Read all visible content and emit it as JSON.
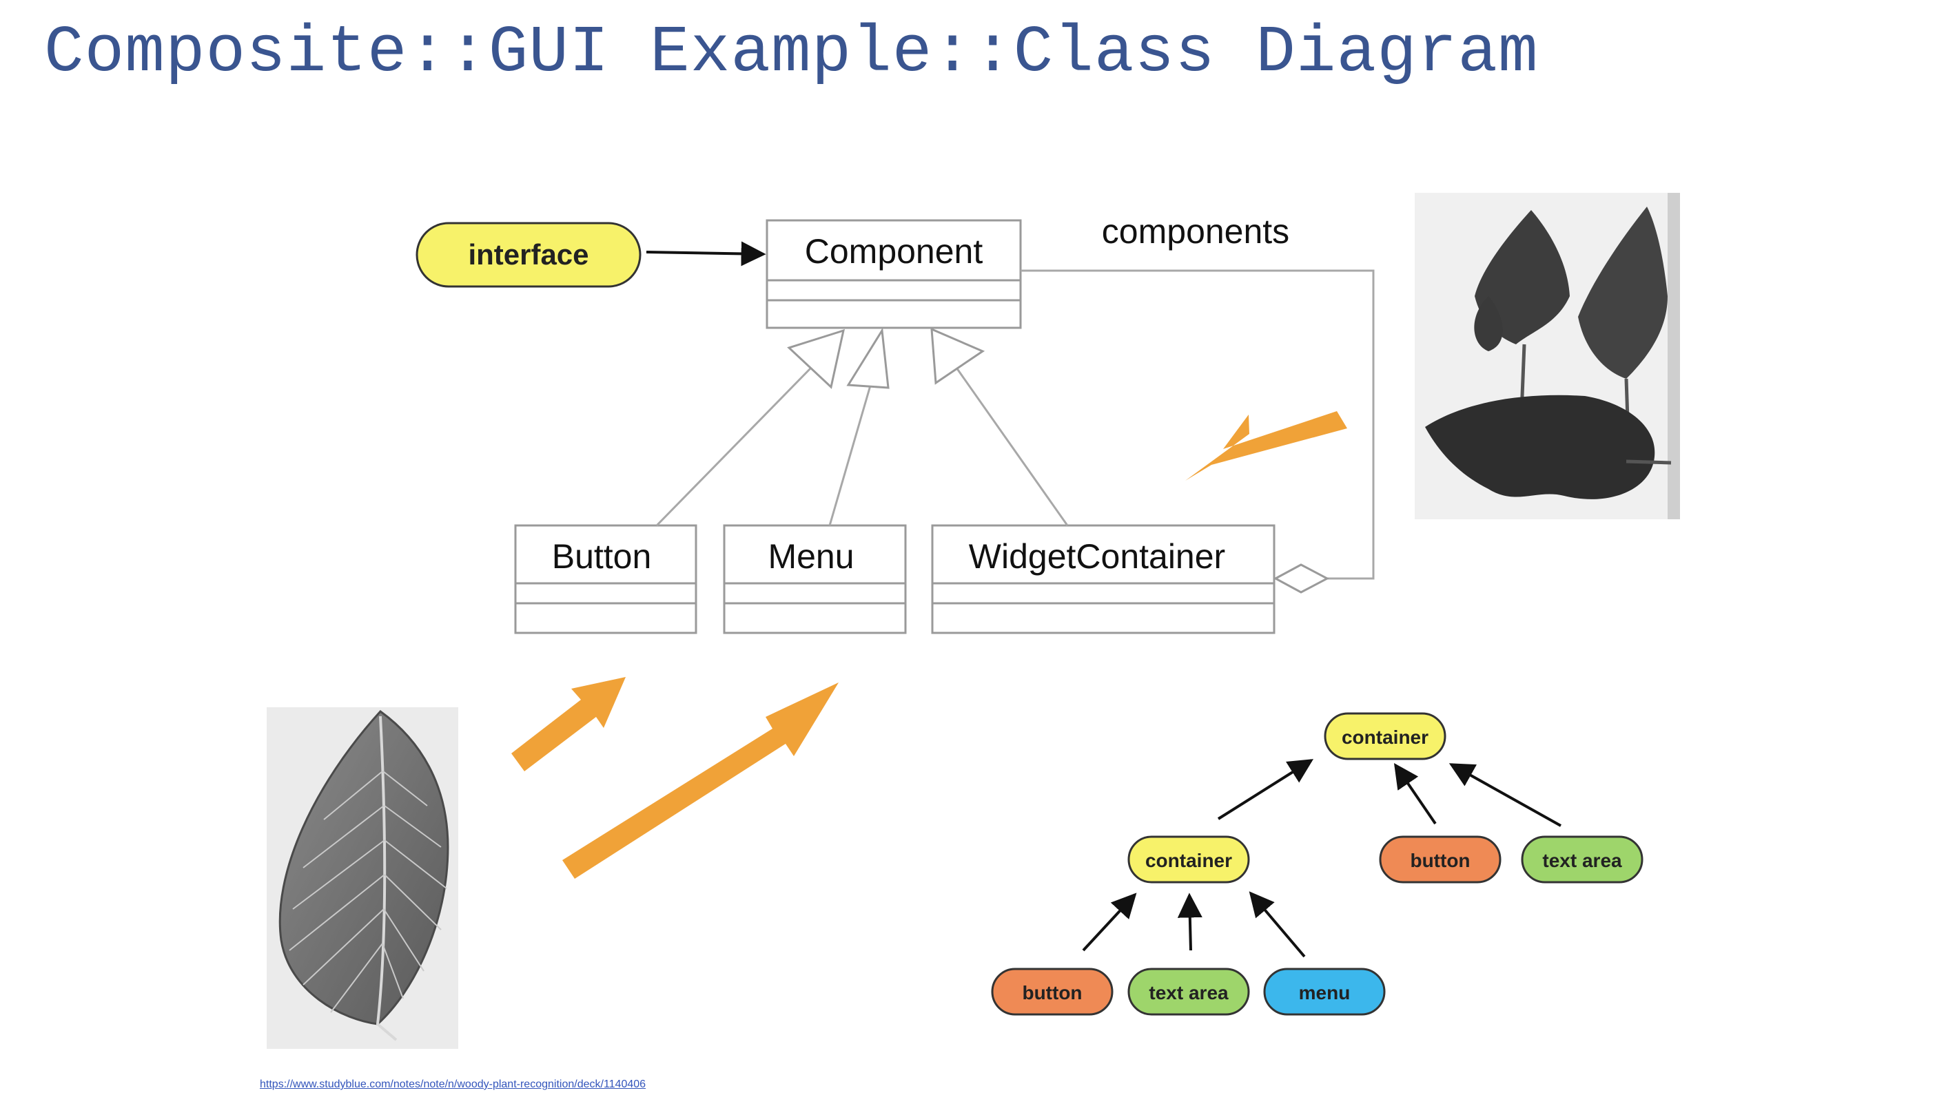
{
  "title": "Composite::GUI Example::Class Diagram",
  "uml": {
    "component": "Component",
    "button": "Button",
    "menu": "Menu",
    "widget_container": "WidgetContainer",
    "association_label": "components"
  },
  "interface_label": "interface",
  "tree": {
    "root": "container",
    "child_container": "container",
    "root_button": "button",
    "root_text_area": "text area",
    "leaf_button": "button",
    "leaf_text_area": "text area",
    "leaf_menu": "menu"
  },
  "source_link": "https://www.studyblue.com/notes/note/n/woody-plant-recognition/deck/1140406",
  "colors": {
    "title": "#3a5590",
    "yellow": "#f7f26a",
    "orange": "#ef8a55",
    "green": "#9ed56b",
    "blue": "#3cb7ec",
    "highlight_arrow": "#f0a238",
    "uml_line": "#a8a8a8"
  },
  "images": [
    "leaf-photo",
    "leaves-photo"
  ]
}
